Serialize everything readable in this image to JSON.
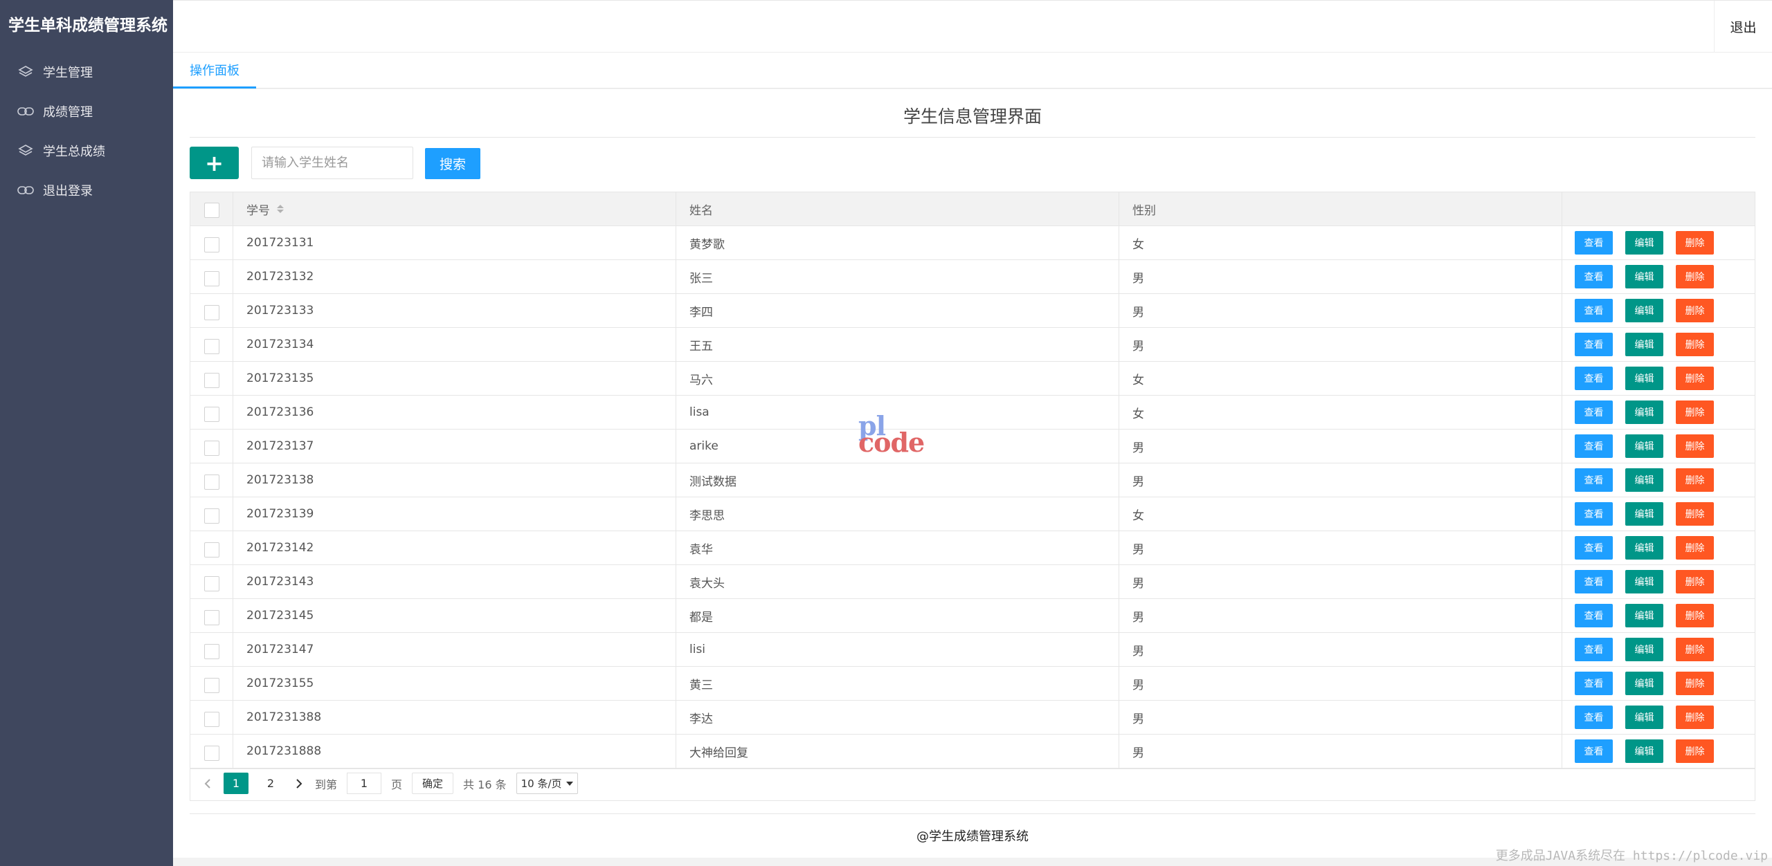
{
  "app": {
    "title": "学生单科成绩管理系统"
  },
  "sidebar": {
    "items": [
      {
        "label": "学生管理",
        "icon": "layers-icon"
      },
      {
        "label": "成绩管理",
        "icon": "link-icon"
      },
      {
        "label": "学生总成绩",
        "icon": "layers-icon"
      },
      {
        "label": "退出登录",
        "icon": "link-icon"
      }
    ]
  },
  "header": {
    "logout_label": "退出"
  },
  "tabs": [
    {
      "label": "操作面板",
      "active": true
    }
  ],
  "main": {
    "title": "学生信息管理界面",
    "add_button": "+",
    "search": {
      "placeholder": "请输入学生姓名",
      "value": ""
    },
    "search_button": "搜索"
  },
  "table": {
    "columns": {
      "id": "学号",
      "name": "姓名",
      "gender": "性别"
    },
    "actions": {
      "view": "查看",
      "edit": "编辑",
      "delete": "删除"
    },
    "rows": [
      {
        "id": "201723131",
        "name": "黄梦歌",
        "gender": "女"
      },
      {
        "id": "201723132",
        "name": "张三",
        "gender": "男"
      },
      {
        "id": "201723133",
        "name": "李四",
        "gender": "男"
      },
      {
        "id": "201723134",
        "name": "王五",
        "gender": "男"
      },
      {
        "id": "201723135",
        "name": "马六",
        "gender": "女"
      },
      {
        "id": "201723136",
        "name": "lisa",
        "gender": "女"
      },
      {
        "id": "201723137",
        "name": "arike",
        "gender": "男"
      },
      {
        "id": "201723138",
        "name": "测试数据",
        "gender": "男"
      },
      {
        "id": "201723139",
        "name": "李思思",
        "gender": "女"
      },
      {
        "id": "201723142",
        "name": "袁华",
        "gender": "男"
      },
      {
        "id": "201723143",
        "name": "袁大头",
        "gender": "男"
      },
      {
        "id": "201723145",
        "name": "都是",
        "gender": "男"
      },
      {
        "id": "201723147",
        "name": "lisi",
        "gender": "男"
      },
      {
        "id": "201723155",
        "name": "黄三",
        "gender": "男"
      },
      {
        "id": "2017231388",
        "name": "李达",
        "gender": "男"
      },
      {
        "id": "2017231888",
        "name": "大神给回复",
        "gender": "男"
      }
    ]
  },
  "pager": {
    "pages": [
      "1",
      "2"
    ],
    "current": "1",
    "goto_label": "到第",
    "goto_value": "1",
    "page_unit": "页",
    "confirm_label": "确定",
    "total_label": "共 16 条",
    "page_size_label": "10 条/页"
  },
  "footer": {
    "text": "@学生成绩管理系统"
  },
  "watermark": {
    "center_top": "pl",
    "center_bottom": "code",
    "corner": "更多成品JAVA系统尽在 https://plcode.vip"
  },
  "colors": {
    "sidebar_bg": "#3f475e",
    "primary_green": "#009688",
    "primary_blue": "#1E9FFF",
    "danger_orange": "#FF5722"
  }
}
